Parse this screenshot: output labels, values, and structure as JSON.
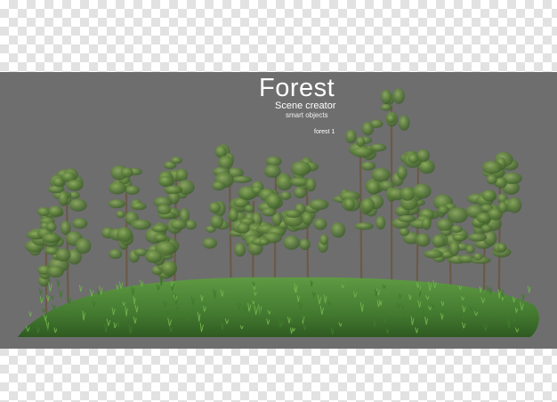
{
  "header": {
    "title": "Forest",
    "subtitle": "Scene creator",
    "tagline": "smart objects"
  },
  "scene_label": "forest 1",
  "colors": {
    "backdrop": "#6e6e6e",
    "checker_light": "#ffffff",
    "checker_dark": "#e2e2e2",
    "grass": "#4f8a3a",
    "foliage": "#5b7f3e",
    "trunk": "#6b5a48"
  }
}
